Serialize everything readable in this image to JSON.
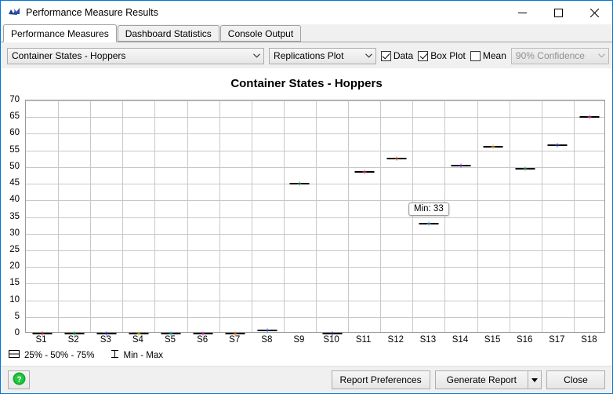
{
  "window": {
    "title": "Performance Measure Results",
    "icon": "chart-app-icon",
    "minimize_label": "─",
    "maximize_label": "□",
    "close_label": "✕"
  },
  "tabs": [
    {
      "label": "Performance Measures",
      "active": true
    },
    {
      "label": "Dashboard Statistics",
      "active": false
    },
    {
      "label": "Console Output",
      "active": false
    }
  ],
  "toolbar": {
    "measure_select": {
      "value": "Container States - Hoppers"
    },
    "plot_select": {
      "value": "Replications Plot"
    },
    "data_checkbox": {
      "label": "Data",
      "checked": true
    },
    "boxplot_checkbox": {
      "label": "Box Plot",
      "checked": true
    },
    "mean_checkbox": {
      "label": "Mean",
      "checked": false
    },
    "confidence_select": {
      "value": "90% Confidence",
      "disabled": true
    }
  },
  "chart_legend": [
    {
      "icon": "quartile-box-icon",
      "label": "25% - 50% - 75%"
    },
    {
      "icon": "min-max-whisker-icon",
      "label": "Min - Max"
    }
  ],
  "footer": {
    "help_button": {
      "icon": "help-question-icon",
      "label": "?"
    },
    "report_preferences": "Report Preferences",
    "generate_report": "Generate Report",
    "generate_report_arrow": "▼",
    "close": "Close"
  },
  "chart_data": {
    "type": "scatter",
    "title": "Container States - Hoppers",
    "xlabel": "",
    "ylabel": "",
    "grid": true,
    "ylim": [
      0,
      70
    ],
    "yticks": [
      0,
      5,
      10,
      15,
      20,
      25,
      30,
      35,
      40,
      45,
      50,
      55,
      60,
      65,
      70
    ],
    "categories": [
      "S1",
      "S2",
      "S3",
      "S4",
      "S5",
      "S6",
      "S7",
      "S8",
      "S9",
      "S10",
      "S11",
      "S12",
      "S13",
      "S14",
      "S15",
      "S16",
      "S17",
      "S18"
    ],
    "values": [
      0,
      0,
      0,
      0,
      0,
      0,
      0,
      1,
      45,
      0,
      48.5,
      52.5,
      33,
      50.5,
      56,
      49.5,
      56.5,
      65
    ],
    "point_colors": [
      "#cc3333",
      "#1e9e4a",
      "#2a3fbf",
      "#d6c21a",
      "#1fb5c4",
      "#c038c0",
      "#e07820",
      "#2a5fd0",
      "#1e9e4a",
      "#4a2a8a",
      "#cc3a6a",
      "#c7532a",
      "#3c9bd6",
      "#8a2ec0",
      "#d99b1c",
      "#3aa05a",
      "#2a3fbf",
      "#c93a9a"
    ],
    "tooltip": {
      "text": "Min: 33",
      "category": "S13"
    }
  }
}
